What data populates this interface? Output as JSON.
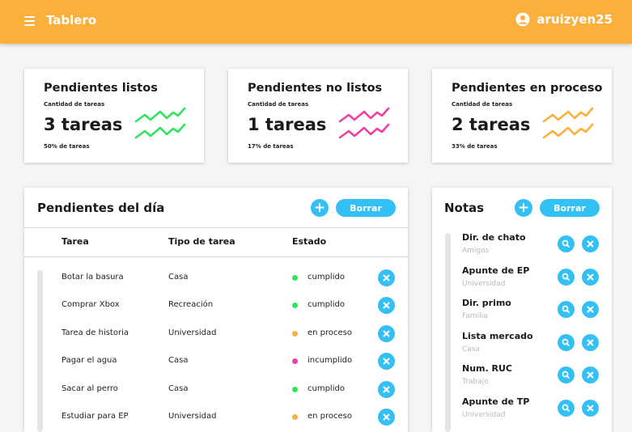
{
  "header": {
    "title": "Tablero",
    "username": "aruizyen25"
  },
  "stats": [
    {
      "title": "Pendientes listos",
      "subtitle": "Cantidad de tareas",
      "value": "3 tareas",
      "percent": "50% de tareas",
      "color": "#2ee65d"
    },
    {
      "title": "Pendientes no listos",
      "subtitle": "Cantidad de tareas",
      "value": "1 tareas",
      "percent": "17% de tareas",
      "color": "#ef3fa6"
    },
    {
      "title": "Pendientes en proceso",
      "subtitle": "Cantidad de tareas",
      "value": "2 tareas",
      "percent": "33% de tareas",
      "color": "#fbb03b"
    }
  ],
  "tasks": {
    "title": "Pendientes del día",
    "add_label": "+",
    "clear_label": "Borrar",
    "columns": [
      "Tarea",
      "Tipo de tarea",
      "Estado"
    ],
    "rows": [
      {
        "task": "Botar la basura",
        "type": "Casa",
        "status": "cumplido",
        "status_color": "#2ee65d"
      },
      {
        "task": "Comprar Xbox",
        "type": "Recreación",
        "status": "cumplido",
        "status_color": "#2ee65d"
      },
      {
        "task": "Tarea de historia",
        "type": "Universidad",
        "status": "en proceso",
        "status_color": "#fbb03b"
      },
      {
        "task": "Pagar el agua",
        "type": "Casa",
        "status": "incumplido",
        "status_color": "#ef3fa6"
      },
      {
        "task": "Sacar al perro",
        "type": "Casa",
        "status": "cumplido",
        "status_color": "#2ee65d"
      },
      {
        "task": "Estudiar para EP",
        "type": "Universidad",
        "status": "en proceso",
        "status_color": "#fbb03b"
      }
    ]
  },
  "notes": {
    "title": "Notas",
    "add_label": "+",
    "clear_label": "Borrar",
    "items": [
      {
        "title": "Dir. de chato",
        "category": "Amigos"
      },
      {
        "title": "Apunte de EP",
        "category": "Universidad"
      },
      {
        "title": "Dir. primo",
        "category": "Familia"
      },
      {
        "title": "Lista mercado",
        "category": "Casa"
      },
      {
        "title": "Num. RUC",
        "category": "Trabajo"
      },
      {
        "title": "Apunte de TP",
        "category": "Universidad"
      }
    ]
  },
  "colors": {
    "accent": "#fbb03b",
    "button": "#33c1f5"
  },
  "icons": {
    "menu": "menu-icon",
    "user": "user-circle-icon",
    "add": "plus-icon",
    "delete": "close-icon",
    "view": "search-icon",
    "trend": "trend-line-icon"
  }
}
